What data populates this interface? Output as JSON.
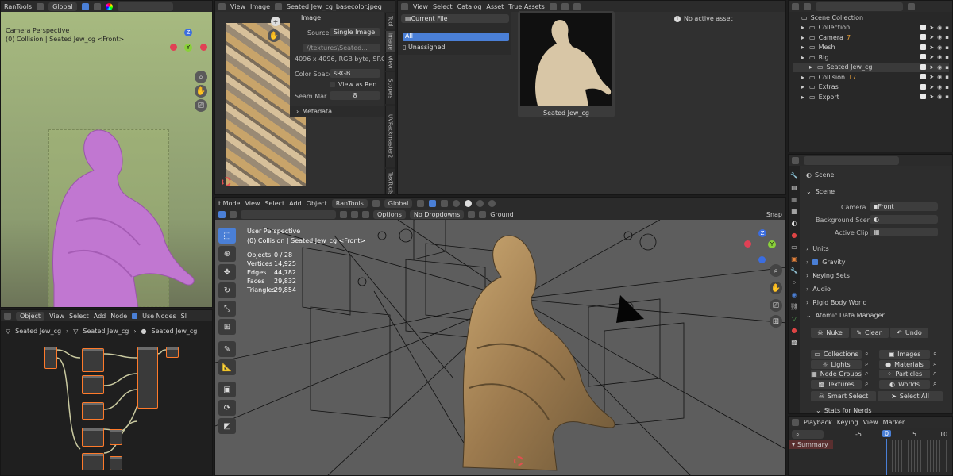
{
  "camera_view": {
    "header": {
      "menu": "RanTools",
      "transform": "Global"
    },
    "title": "Camera Perspective",
    "subtitle": "(0) Collision | Seated Jew_cg <Front>",
    "gizmo": {
      "z": "Z",
      "y": "Y"
    }
  },
  "image_editor": {
    "header": {
      "view": "View",
      "image": "Image",
      "filename": "Seated Jew_cg_basecolor.jpeg"
    },
    "panel_title": "Image",
    "source_label": "Source",
    "source_value": "Single Image",
    "path": "//textures\\Seated...",
    "info": "4096 x 4096,  RGB byte,  SRG...",
    "color_space_label": "Color Space",
    "color_space_value": "sRGB",
    "view_as_render": "View as Ren...",
    "seam_label": "Seam Mar...",
    "seam_value": "8",
    "metadata": "Metadata",
    "tabs": [
      "Tool",
      "Image",
      "View",
      "Scopes",
      "UVPackmaster2",
      "TexTools",
      "U"
    ]
  },
  "asset_browser": {
    "header": {
      "view": "View",
      "select": "Select",
      "catalog": "Catalog",
      "asset": "Asset",
      "true_assets": "True Assets"
    },
    "current_file": "Current File",
    "catalogs": [
      "All",
      "Unassigned"
    ],
    "asset_name": "Seated Jew_cg",
    "no_active": "No active asset"
  },
  "outliner": {
    "rows": [
      {
        "name": "Scene Collection",
        "indent": 0
      },
      {
        "name": "Collection",
        "indent": 1
      },
      {
        "name": "Camera",
        "indent": 1,
        "count": "7"
      },
      {
        "name": "Mesh",
        "indent": 1
      },
      {
        "name": "Rig",
        "indent": 1
      },
      {
        "name": "Seated Jew_cg",
        "indent": 2
      },
      {
        "name": "Collision",
        "indent": 1,
        "count": "17"
      },
      {
        "name": "Extras",
        "indent": 1
      },
      {
        "name": "Export",
        "indent": 1
      }
    ]
  },
  "node_editor": {
    "header": {
      "mode": "Object",
      "view": "View",
      "select": "Select",
      "add": "Add",
      "node": "Node",
      "use_nodes": "Use Nodes",
      "sl": "Sl"
    },
    "breadcrumb": [
      "Seated Jew_cg",
      "Seated Jew_cg",
      "Seated Jew_cg"
    ]
  },
  "viewport": {
    "header": {
      "mode": "t Mode",
      "view": "View",
      "select": "Select",
      "add": "Add",
      "object": "Object",
      "rantools": "RanTools",
      "transform": "Global"
    },
    "header2": {
      "options": "Options",
      "no_dropdowns": "No Dropdowns",
      "ground": "Ground",
      "snap": "Snap"
    },
    "title": "User Perspective",
    "subtitle": "(0) Collision | Seated Jew_cg <Front>",
    "stats": [
      {
        "label": "Objects",
        "value": "0 / 28"
      },
      {
        "label": "Vertices",
        "value": "14,925"
      },
      {
        "label": "Edges",
        "value": "44,782"
      },
      {
        "label": "Faces",
        "value": "29,832"
      },
      {
        "label": "Triangles",
        "value": "29,854"
      }
    ],
    "gizmo": {
      "z": "Z",
      "y": "Y"
    }
  },
  "properties": {
    "scene": "Scene",
    "scene_section": "Scene",
    "camera_label": "Camera",
    "camera_value": "Front",
    "background_label": "Background Scene",
    "active_clip_label": "Active Clip",
    "sections": [
      "Units",
      "Gravity",
      "Keying Sets",
      "Audio",
      "Rigid Body World"
    ],
    "atomic": "Atomic Data Manager",
    "actions": [
      "Nuke",
      "Clean",
      "Undo"
    ],
    "grid": [
      "Collections",
      "Images",
      "Lights",
      "Materials",
      "Node Groups",
      "Particles",
      "Textures",
      "Worlds"
    ],
    "smart_select": "Smart Select",
    "select_all": "Select All",
    "stats_for_nerds": "Stats for Nerds"
  },
  "timeline": {
    "header": {
      "playback": "Playback",
      "keying": "Keying",
      "view": "View",
      "marker": "Marker"
    },
    "frames": [
      "-5",
      "0",
      "5",
      "10"
    ],
    "summary": "Summary"
  }
}
